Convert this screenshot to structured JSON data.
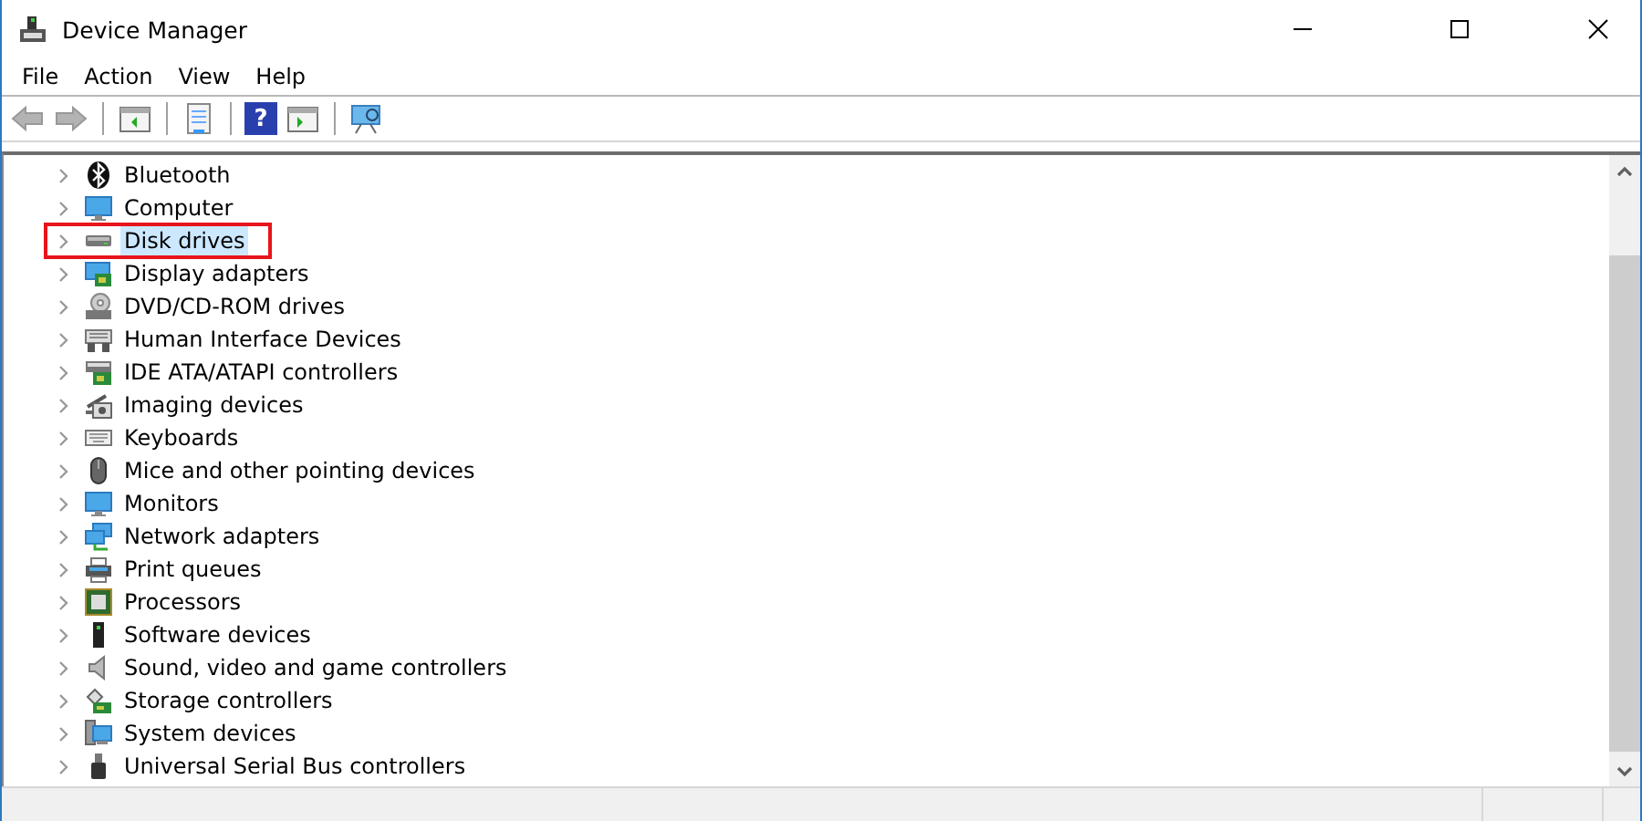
{
  "window": {
    "title": "Device Manager"
  },
  "menu": [
    {
      "label": "File"
    },
    {
      "label": "Action"
    },
    {
      "label": "View"
    },
    {
      "label": "Help"
    }
  ],
  "toolbar": [
    {
      "kind": "back",
      "disabled": true
    },
    {
      "kind": "forward",
      "disabled": true
    },
    {
      "kind": "sep"
    },
    {
      "kind": "console-tree"
    },
    {
      "kind": "sep"
    },
    {
      "kind": "properties"
    },
    {
      "kind": "sep"
    },
    {
      "kind": "help",
      "label": "?"
    },
    {
      "kind": "action-pane"
    },
    {
      "kind": "sep"
    },
    {
      "kind": "scan"
    }
  ],
  "tree": {
    "items": [
      {
        "label": "Bluetooth",
        "kind": "bluetooth",
        "expanded": false,
        "selected": false,
        "highlighted": false
      },
      {
        "label": "Computer",
        "kind": "monitor",
        "expanded": false,
        "selected": false,
        "highlighted": false
      },
      {
        "label": "Disk drives",
        "kind": "disk",
        "expanded": false,
        "selected": true,
        "highlighted": true
      },
      {
        "label": "Display adapters",
        "kind": "display-adapter",
        "expanded": false,
        "selected": false,
        "highlighted": false
      },
      {
        "label": "DVD/CD-ROM drives",
        "kind": "dvd",
        "expanded": false,
        "selected": false,
        "highlighted": false
      },
      {
        "label": "Human Interface Devices",
        "kind": "hid",
        "expanded": false,
        "selected": false,
        "highlighted": false
      },
      {
        "label": "IDE ATA/ATAPI controllers",
        "kind": "ide",
        "expanded": false,
        "selected": false,
        "highlighted": false
      },
      {
        "label": "Imaging devices",
        "kind": "camera",
        "expanded": false,
        "selected": false,
        "highlighted": false
      },
      {
        "label": "Keyboards",
        "kind": "keyboard",
        "expanded": false,
        "selected": false,
        "highlighted": false
      },
      {
        "label": "Mice and other pointing devices",
        "kind": "mouse",
        "expanded": false,
        "selected": false,
        "highlighted": false
      },
      {
        "label": "Monitors",
        "kind": "monitor",
        "expanded": false,
        "selected": false,
        "highlighted": false
      },
      {
        "label": "Network adapters",
        "kind": "network",
        "expanded": false,
        "selected": false,
        "highlighted": false
      },
      {
        "label": "Print queues",
        "kind": "printer",
        "expanded": false,
        "selected": false,
        "highlighted": false
      },
      {
        "label": "Processors",
        "kind": "chip",
        "expanded": false,
        "selected": false,
        "highlighted": false
      },
      {
        "label": "Software devices",
        "kind": "software",
        "expanded": false,
        "selected": false,
        "highlighted": false
      },
      {
        "label": "Sound, video and game controllers",
        "kind": "speaker",
        "expanded": false,
        "selected": false,
        "highlighted": false
      },
      {
        "label": "Storage controllers",
        "kind": "storage",
        "expanded": false,
        "selected": false,
        "highlighted": false
      },
      {
        "label": "System devices",
        "kind": "system",
        "expanded": false,
        "selected": false,
        "highlighted": false
      },
      {
        "label": "Universal Serial Bus controllers",
        "kind": "usb",
        "expanded": false,
        "selected": false,
        "highlighted": false
      }
    ]
  }
}
